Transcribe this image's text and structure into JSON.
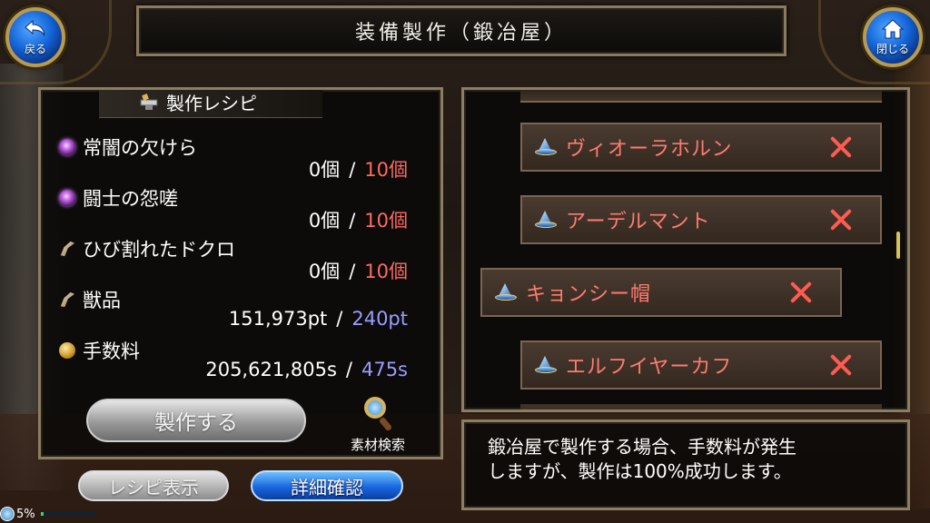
{
  "header": {
    "title": "装備製作（鍛冶屋）",
    "back_label": "戻る",
    "close_label": "閉じる"
  },
  "recipe": {
    "heading": "製作レシピ",
    "materials": [
      {
        "name": "常闇の欠けら",
        "icon": "purple-orb-icon",
        "owned": "0個",
        "required": "10個",
        "required_color": "#ff6a60"
      },
      {
        "name": "闘士の怨嗟",
        "icon": "purple-orb-icon",
        "owned": "0個",
        "required": "10個",
        "required_color": "#ff6a60"
      },
      {
        "name": "ひび割れたドクロ",
        "icon": "claw-icon",
        "owned": "0個",
        "required": "10個",
        "required_color": "#ff6a60"
      },
      {
        "name": "獣品",
        "icon": "claw-icon",
        "owned": "151,973pt",
        "required": "240pt",
        "required_color": "#9a9cff"
      },
      {
        "name": "手数料",
        "icon": "coin-icon",
        "owned": "205,621,805s",
        "required": "475s",
        "required_color": "#9a9cff"
      }
    ],
    "separator": "/",
    "craft_label": "製作する",
    "search_label": "素材検索"
  },
  "bottom_buttons": {
    "recipe_view": "レシピ表示",
    "detail_check": "詳細確認"
  },
  "item_list": {
    "items": [
      {
        "name": "ヴィオーラホルン",
        "icon": "wizard-hat-icon",
        "selected": false
      },
      {
        "name": "アーデルマント",
        "icon": "wizard-hat-icon",
        "selected": false
      },
      {
        "name": "キョンシー帽",
        "icon": "wizard-hat-icon",
        "selected": true
      },
      {
        "name": "エルフイヤーカフ",
        "icon": "wizard-hat-icon",
        "selected": false
      }
    ],
    "unavailable_mark_color": "#ff5b50"
  },
  "info": {
    "line1": "鍛冶屋で製作する場合、手数料が発生",
    "line2": "しますが、製作は100%成功します。"
  },
  "status": {
    "percent": "5%",
    "fill_fraction": 0.05
  }
}
